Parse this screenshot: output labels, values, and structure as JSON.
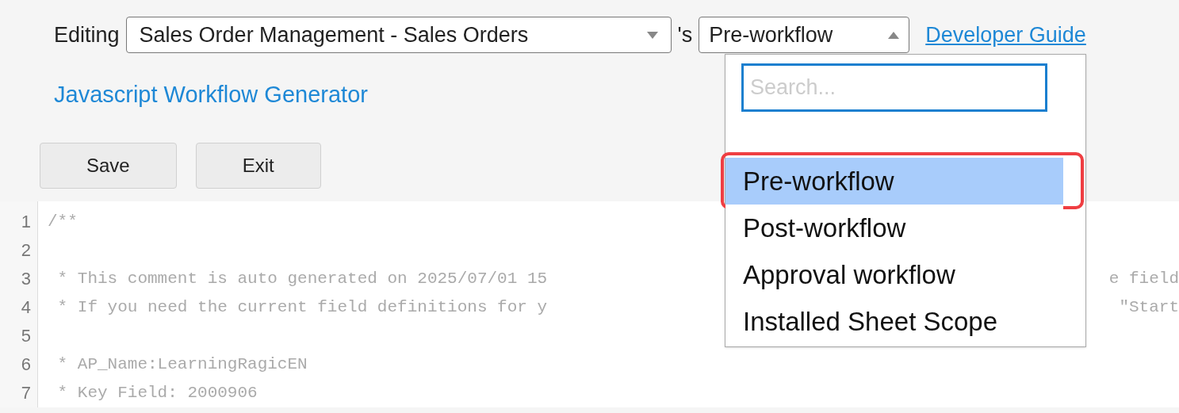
{
  "header": {
    "label": "Editing",
    "sheet_select": {
      "value": "Sales Order Management - Sales Orders",
      "expanded": false
    },
    "possessive": "'s",
    "workflow_select": {
      "value": "Pre-workflow",
      "expanded": true
    },
    "guide_link": "Developer Guide"
  },
  "generator_link": "Javascript Workflow Generator",
  "buttons": [
    "Save",
    "Exit"
  ],
  "dropdown": {
    "search": {
      "placeholder": "Search..."
    },
    "options": [
      {
        "label": "Pre-workflow",
        "selected": true,
        "outlined": true
      },
      {
        "label": "Post-workflow",
        "selected": false,
        "outlined": false
      },
      {
        "label": "Approval workflow",
        "selected": false,
        "outlined": false
      },
      {
        "label": "Installed Sheet Scope",
        "selected": false,
        "outlined": false
      }
    ]
  },
  "code": {
    "lines": [
      {
        "number": "1",
        "text": "/**"
      },
      {
        "number": "2"
      },
      {
        "number": "3",
        "text": " * This comment is auto generated on 2025/07/01 15",
        "text_right": "e field"
      },
      {
        "number": "4",
        "text": " * If you need the current field definitions for y",
        "text_right": "\"Start"
      },
      {
        "number": "5"
      },
      {
        "number": "6",
        "text": " * AP_Name:LearningRagicEN"
      },
      {
        "number": "7",
        "text": " * Key Field: 2000906"
      }
    ]
  }
}
